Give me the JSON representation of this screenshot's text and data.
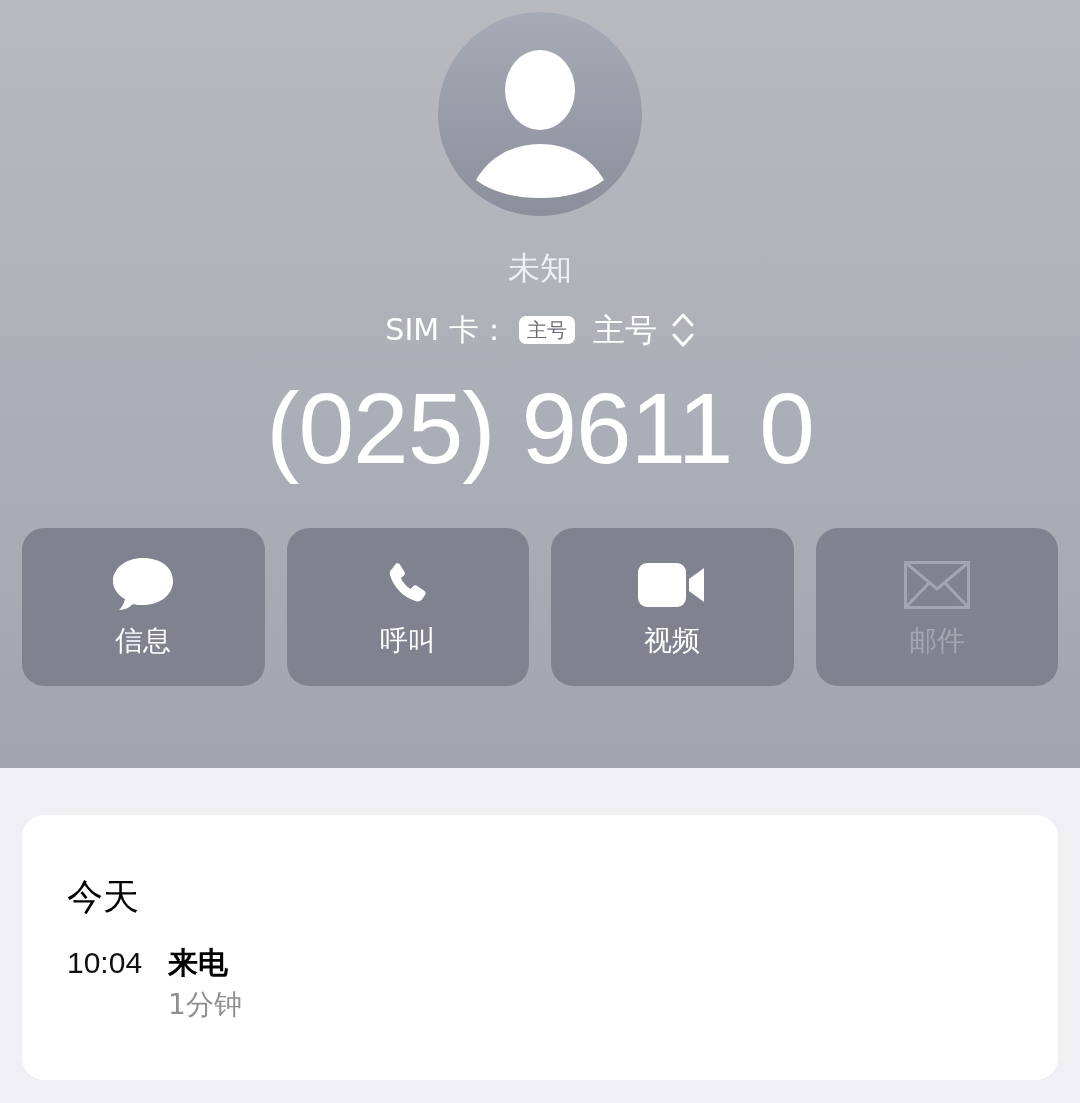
{
  "contact": {
    "name": "未知",
    "sim_label": "SIM 卡：",
    "sim_badge": "主号",
    "sim_value": "主号",
    "number": "(025) 9611 0"
  },
  "actions": [
    {
      "kind": "message",
      "label": "信息",
      "disabled": false
    },
    {
      "kind": "call",
      "label": "呼叫",
      "disabled": false
    },
    {
      "kind": "video",
      "label": "视频",
      "disabled": false
    },
    {
      "kind": "mail",
      "label": "邮件",
      "disabled": true
    }
  ],
  "history": {
    "day": "今天",
    "entries": [
      {
        "time": "10:04",
        "type": "来电",
        "duration": "1分钟"
      }
    ]
  }
}
